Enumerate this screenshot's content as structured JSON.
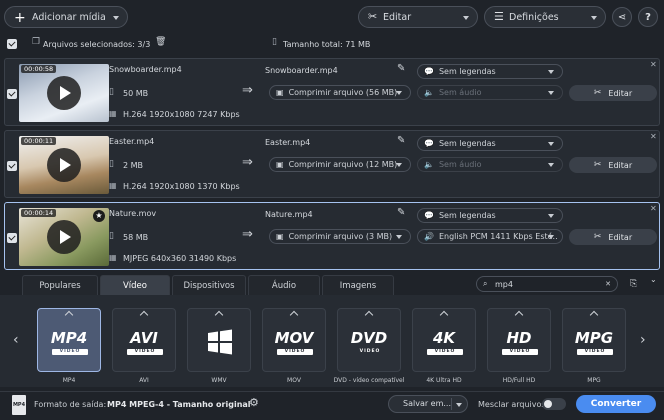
{
  "toolbar": {
    "add_media": "Adicionar mídia",
    "edit": "Editar",
    "settings": "Definições",
    "help": "?"
  },
  "selection_bar": {
    "selected_files": "Arquivos selecionados: 3/3",
    "total_size": "Tamanho total: 71 MB"
  },
  "files": [
    {
      "duration": "00:00:58",
      "name": "Snowboarder.mp4",
      "size": "50 MB",
      "codec": "H.264 1920x1080 7247 Kbps",
      "output_name": "Snowboarder.mp4",
      "compress": "Comprimir arquivo (56 MB)",
      "subtitles": "Sem legendas",
      "audio": "Sem áudio",
      "edit": "Editar"
    },
    {
      "duration": "00:00:11",
      "name": "Easter.mp4",
      "size": "2 MB",
      "codec": "H.264 1920x1080 1370 Kbps",
      "output_name": "Easter.mp4",
      "compress": "Comprimir arquivo (12 MB)",
      "subtitles": "Sem legendas",
      "audio": "Sem áudio",
      "edit": "Editar"
    },
    {
      "duration": "00:00:14",
      "name": "Nature.mov",
      "size": "58 MB",
      "codec": "MJPEG 640x360 31490 Kbps",
      "output_name": "Nature.mp4",
      "compress": "Comprimir arquivo (3 MB)",
      "subtitles": "Sem legendas",
      "audio": "English PCM 1411 Kbps Esté...",
      "edit": "Editar"
    }
  ],
  "tabs": [
    "Populares",
    "Vídeo",
    "Dispositivos",
    "Áudio",
    "Imagens"
  ],
  "active_tab": "Vídeo",
  "search": {
    "value": "mp4"
  },
  "formats": [
    {
      "logo": "MP4",
      "badge": "VIDEO",
      "caption": "MP4"
    },
    {
      "logo": "AVI",
      "badge": "VIDEO",
      "caption": "AVI"
    },
    {
      "logo": "",
      "badge": "",
      "caption": "WMV"
    },
    {
      "logo": "MOV",
      "badge": "VIDEO",
      "caption": "MOV"
    },
    {
      "logo": "DVD",
      "badge": "VIDEO",
      "caption": "DVD - vídeo compatível"
    },
    {
      "logo": "4K",
      "badge": "VIDEO",
      "caption": "4K Ultra HD"
    },
    {
      "logo": "HD",
      "badge": "VIDEO",
      "caption": "HD/Full HD"
    },
    {
      "logo": "MPG",
      "badge": "VIDEO",
      "caption": "MPG"
    }
  ],
  "bottom": {
    "output_format_label": "Formato de saída:",
    "output_format_value": "MP4 MPEG-4 - Tamanho original",
    "save_to": "Salvar em...",
    "merge_files": "Mesclar arquivos:",
    "convert": "Converter"
  },
  "colors": {
    "accent": "#4a8cf0",
    "background": "#1f2329",
    "selected_row_border": "#a6c3f0"
  }
}
